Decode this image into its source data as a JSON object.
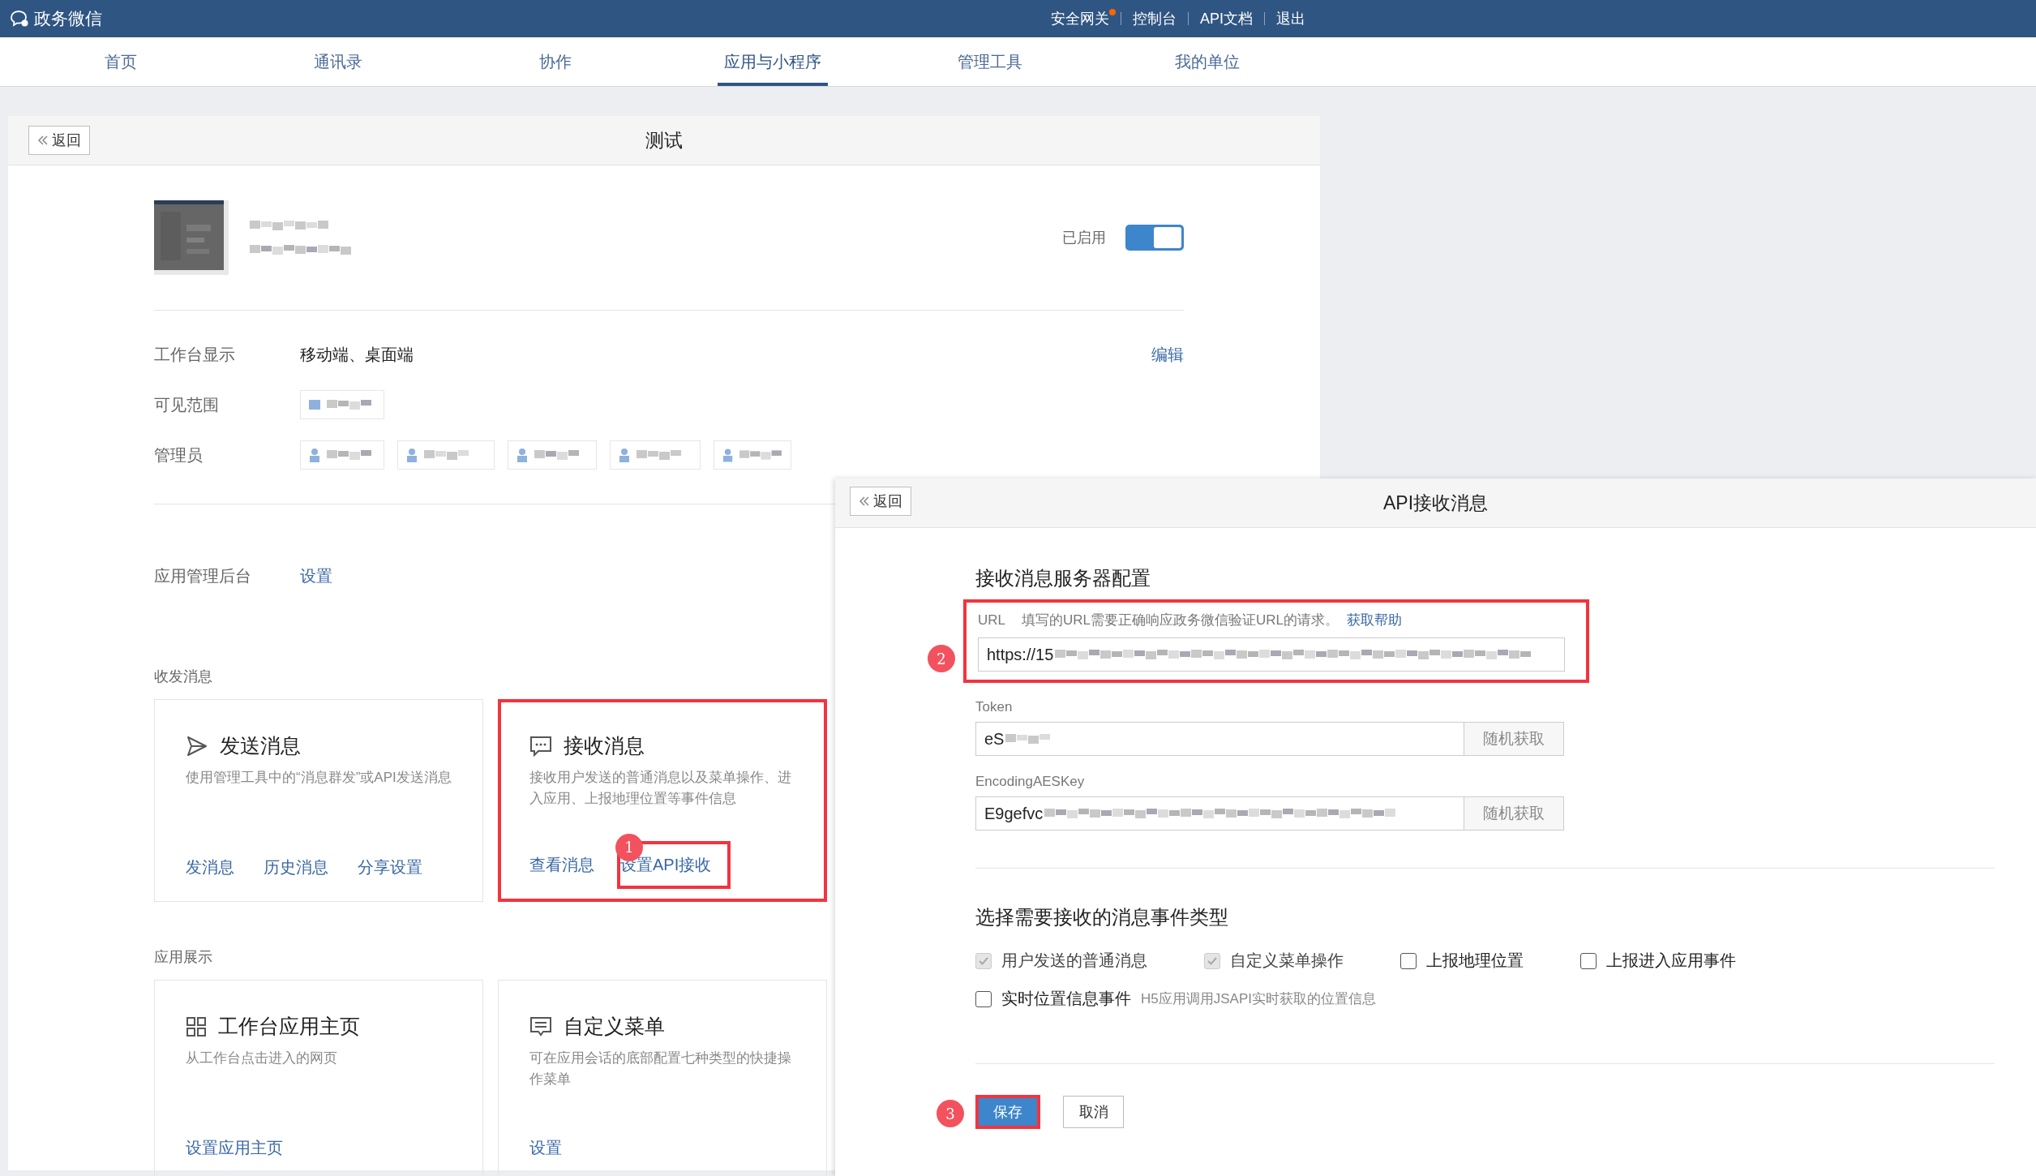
{
  "topbar": {
    "logo": "政务微信",
    "links": [
      {
        "label": "安全网关",
        "notify": true
      },
      {
        "label": "控制台",
        "notify": false
      },
      {
        "label": "API文档",
        "notify": false
      },
      {
        "label": "退出",
        "notify": false
      }
    ]
  },
  "nav": [
    {
      "label": "首页",
      "selected": false
    },
    {
      "label": "通讯录",
      "selected": false
    },
    {
      "label": "协作",
      "selected": false
    },
    {
      "label": "应用与小程序",
      "selected": true
    },
    {
      "label": "管理工具",
      "selected": false
    },
    {
      "label": "我的单位",
      "selected": false
    }
  ],
  "app_panel": {
    "back": "返回",
    "title": "测试",
    "status": "已启用",
    "enabled": true,
    "rows": [
      {
        "kind": "text",
        "label": "工作台显示",
        "value": "移动端、桌面端",
        "action": "编辑"
      },
      {
        "kind": "tags",
        "label": "可见范围",
        "tags": [
          {
            "kind": "folder"
          }
        ]
      },
      {
        "kind": "tags",
        "label": "管理员",
        "tags": [
          {
            "kind": "person"
          },
          {
            "kind": "person"
          },
          {
            "kind": "person"
          },
          {
            "kind": "person"
          },
          {
            "kind": "person"
          }
        ]
      }
    ],
    "backend": {
      "label": "应用管理后台",
      "link": "设置"
    },
    "sections": [
      {
        "title": "收发消息",
        "cards": [
          {
            "title": "发送消息",
            "desc": "使用管理工具中的“消息群发”或API发送消息",
            "highlighted": false,
            "links": [
              {
                "label": "发消息",
                "highlighted": false
              },
              {
                "label": "历史消息",
                "highlighted": false
              },
              {
                "label": "分享设置",
                "highlighted": false
              }
            ]
          },
          {
            "title": "接收消息",
            "desc": "接收用户发送的普通消息以及菜单操作、进入应用、上报地理位置等事件信息",
            "highlighted": true,
            "links": [
              {
                "label": "查看消息",
                "highlighted": false
              },
              {
                "label": "设置API接收",
                "highlighted": true,
                "badge": "1"
              }
            ]
          }
        ]
      },
      {
        "title": "应用展示",
        "cards": [
          {
            "title": "工作台应用主页",
            "desc": "从工作台点击进入的网页",
            "highlighted": false,
            "links": [
              {
                "label": "设置应用主页",
                "highlighted": false
              }
            ]
          },
          {
            "title": "自定义菜单",
            "desc": "可在应用会话的底部配置七种类型的快捷操作菜单",
            "highlighted": false,
            "links": [
              {
                "label": "设置",
                "highlighted": false
              }
            ]
          }
        ]
      }
    ]
  },
  "api_panel": {
    "back": "返回",
    "title": "API接收消息",
    "server_heading": "接收消息服务器配置",
    "url": {
      "label": "URL",
      "hint": "填写的URL需要正确响应政务微信验证URL的请求。",
      "help": "获取帮助",
      "value": "https://15",
      "badge": "2",
      "highlighted": true
    },
    "keys": [
      {
        "label": "Token",
        "value": "eS",
        "button": "随机获取"
      },
      {
        "label": "EncodingAESKey",
        "value": "E9gefvc",
        "button": "随机获取"
      }
    ],
    "events_heading": "选择需要接收的消息事件类型",
    "events": [
      {
        "label": "用户发送的普通消息",
        "checked": true,
        "disabled": true
      },
      {
        "label": "自定义菜单操作",
        "checked": true,
        "disabled": true
      },
      {
        "label": "上报地理位置",
        "checked": false,
        "disabled": false
      },
      {
        "label": "上报进入应用事件",
        "checked": false,
        "disabled": false
      },
      {
        "label": "实时位置信息事件",
        "checked": false,
        "disabled": false,
        "hint": "H5应用调用JSAPI实时获取的位置信息"
      }
    ],
    "save": {
      "label": "保存",
      "badge": "3",
      "highlighted": true
    },
    "cancel": "取消"
  }
}
